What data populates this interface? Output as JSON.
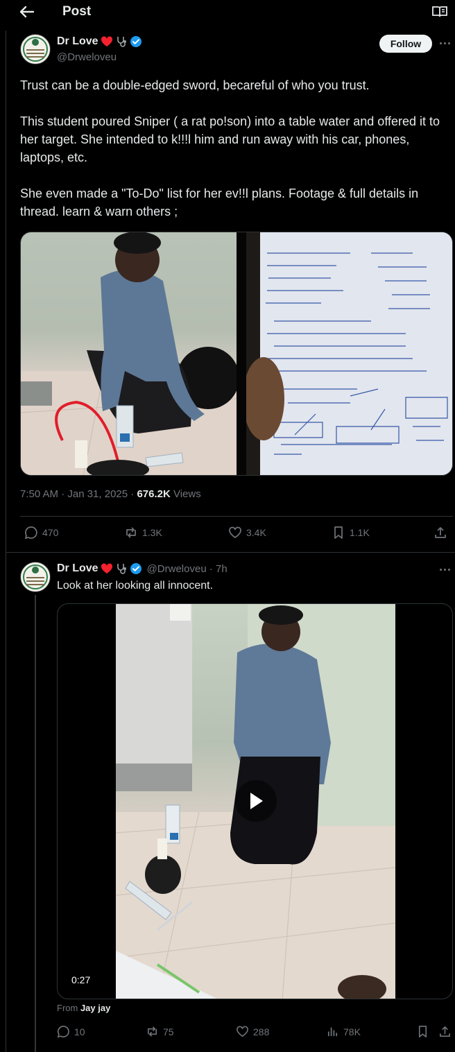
{
  "header": {
    "title": "Post",
    "back_icon": "arrow-left-icon",
    "reader_icon": "open-book-icon"
  },
  "main_post": {
    "author_name": "Dr Love",
    "handle": "@Drweloveu",
    "follow_label": "Follow",
    "text_paragraphs": [
      "Trust can be a double-edged sword, becareful of who you trust.",
      "This student poured Sniper ( a rat po!son) into a table water and offered it to her target. She intended to k!!!l him and run away with his car, phones, laptops, etc.",
      "She even made a \"To-Do\" list for her ev!!l plans. Footage & full details in thread. learn & warn others ;"
    ],
    "timestamp": "7:50 AM · Jan 31, 2025 · ",
    "views_count": "676.2K",
    "views_label": " Views",
    "stats": {
      "replies": "470",
      "reposts": "1.3K",
      "likes": "3.4K",
      "bookmarks": "1.1K"
    }
  },
  "reply_post": {
    "author_name": "Dr Love",
    "handle_time": "@Drweloveu · 7h",
    "text": "Look at her looking all innocent.",
    "video_duration": "0:27",
    "from_prefix": "From ",
    "from_name": "Jay jay",
    "stats": {
      "replies": "10",
      "reposts": "75",
      "likes": "288",
      "views": "78K"
    }
  },
  "colors": {
    "background": "#000000",
    "text": "#e7e9ea",
    "muted": "#71767b",
    "border": "#2f3336",
    "verified": "#1d9bf0",
    "heart": "#f4212e"
  }
}
